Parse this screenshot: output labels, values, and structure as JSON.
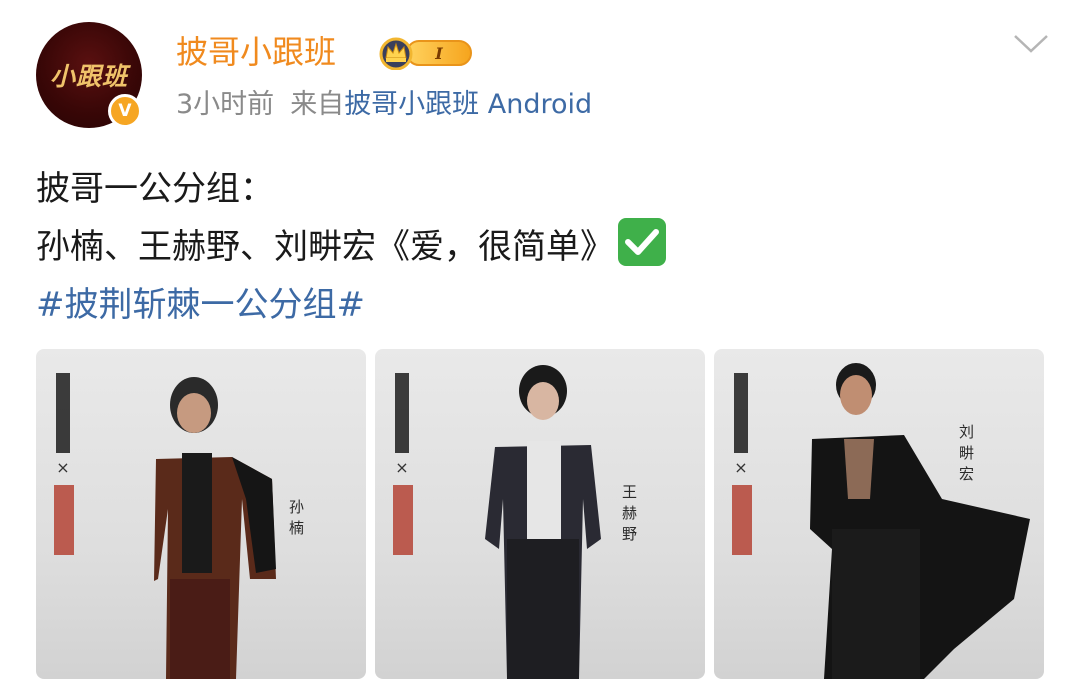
{
  "post": {
    "avatar_text": "小跟班",
    "username": "披哥小跟班",
    "level_badge": "I",
    "time": "3小时前",
    "from_label": "来自",
    "source": "披哥小跟班 Android",
    "verified_mark": "V",
    "icons": [
      "crown-icon",
      "chevron-down-icon",
      "check-mark-emoji"
    ],
    "colors": {
      "username": "#f08a1e",
      "link": "#3d6aa5",
      "meta": "#8a8a8a",
      "badge": "#f6a623"
    }
  },
  "content": {
    "line1": "披哥一公分组：",
    "line2": "孙楠、王赫野、刘畊宏《爱，很简单》",
    "hashtag": "#披荆斩棘一公分组#"
  },
  "photos": [
    {
      "name": "孙楠"
    },
    {
      "name": "王赫野"
    },
    {
      "name": "刘畊宏"
    }
  ]
}
